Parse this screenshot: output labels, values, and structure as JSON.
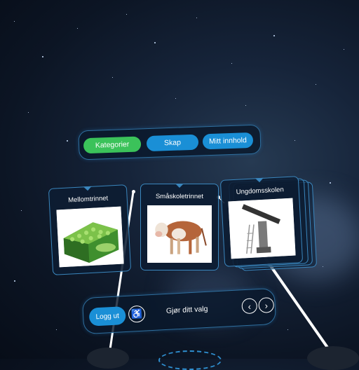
{
  "top_tabs": {
    "categories": "Kategorier",
    "create": "Skap",
    "my_content": "Mitt innhold"
  },
  "cards": [
    {
      "label": "Mellomtrinnet",
      "image": "plant-cells"
    },
    {
      "label": "Småskoletrinnet",
      "image": "cow"
    },
    {
      "label": "Ungdomsskolen",
      "image": "telescope"
    }
  ],
  "bottom_bar": {
    "logout": "Logg ut",
    "prompt": "Gjør ditt valg",
    "accessibility_icon": "wheelchair-icon",
    "prev_icon": "chevron-left-icon",
    "next_icon": "chevron-right-icon"
  },
  "colors": {
    "active_tab": "#3bc25a",
    "tab": "#1a8fd6",
    "border": "#3a86bd"
  }
}
